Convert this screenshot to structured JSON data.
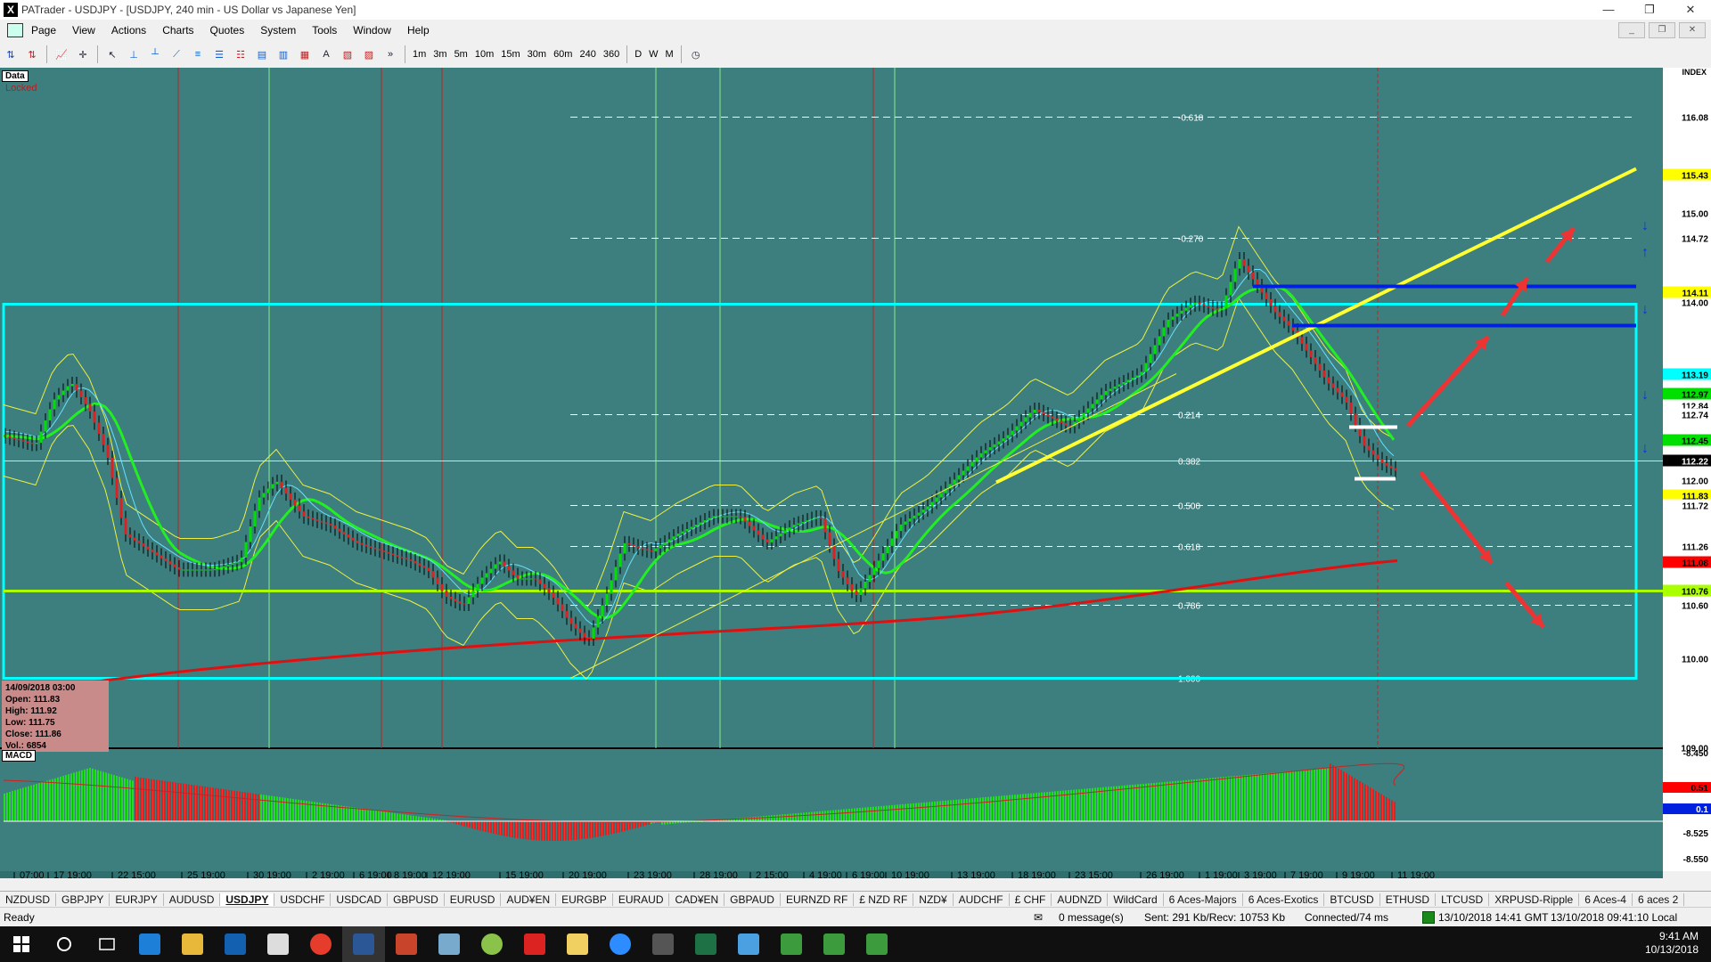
{
  "window": {
    "title": "PATrader - USDJPY - [USDJPY, 240 min - US Dollar vs Japanese Yen]",
    "minimize": "—",
    "restore": "❐",
    "close": "✕"
  },
  "menu": {
    "items": [
      "Page",
      "View",
      "Actions",
      "Charts",
      "Quotes",
      "System",
      "Tools",
      "Window",
      "Help"
    ]
  },
  "toolbar": {
    "timeframes": [
      "1m",
      "3m",
      "5m",
      "10m",
      "15m",
      "30m",
      "60m",
      "240",
      "360"
    ],
    "periods": [
      "D",
      "W",
      "M"
    ],
    "overflow": "»"
  },
  "chart": {
    "data_label": "Data",
    "locked_label": "Locked",
    "index_label": "INDEX",
    "macd_label": "MACD",
    "ohlc": {
      "date": "14/09/2018 03:00",
      "open": "Open: 111.83",
      "high": "High: 111.92",
      "low": "Low: 111.75",
      "close": "Close: 111.86",
      "vol": "Vol.: 6854"
    },
    "price_axis": [
      {
        "label": "116.08",
        "y": 116.08,
        "bg": "#ffffff"
      },
      {
        "label": "115.43",
        "y": 115.43,
        "bg": "#ffff00"
      },
      {
        "label": "115.00",
        "y": 115.0,
        "bg": ""
      },
      {
        "label": "114.72",
        "y": 114.72,
        "bg": "#ffffff"
      },
      {
        "label": "114.11",
        "y": 114.11,
        "bg": "#ffff00"
      },
      {
        "label": "114.00",
        "y": 114.0,
        "bg": ""
      },
      {
        "label": "113.19",
        "y": 113.19,
        "bg": "#00ffff"
      },
      {
        "label": "112.97",
        "y": 112.97,
        "bg": "#00e000"
      },
      {
        "label": "112.84",
        "y": 112.84,
        "bg": "#ffffff"
      },
      {
        "label": "112.74",
        "y": 112.74,
        "bg": "#ffffff"
      },
      {
        "label": "112.45",
        "y": 112.45,
        "bg": "#00e000"
      },
      {
        "label": "112.22",
        "y": 112.22,
        "bg": "#000000"
      },
      {
        "label": "112.00",
        "y": 112.0,
        "bg": ""
      },
      {
        "label": "111.83",
        "y": 111.83,
        "bg": "#ffff00"
      },
      {
        "label": "111.72",
        "y": 111.72,
        "bg": "#ffffff"
      },
      {
        "label": "111.26",
        "y": 111.26,
        "bg": "#ffffff"
      },
      {
        "label": "111.08",
        "y": 111.08,
        "bg": "#ff0000"
      },
      {
        "label": "110.76",
        "y": 110.76,
        "bg": "#aaff00"
      },
      {
        "label": "110.60",
        "y": 110.6,
        "bg": "#ffffff"
      },
      {
        "label": "110.00",
        "y": 110.0,
        "bg": ""
      },
      {
        "label": "109.00",
        "y": 109.0,
        "bg": ""
      }
    ],
    "fib_levels": [
      {
        "label": "-0.618",
        "y": 116.08
      },
      {
        "label": "-0.270",
        "y": 114.72
      },
      {
        "label": "0.214",
        "y": 112.74
      },
      {
        "label": "0.382",
        "y": 112.22
      },
      {
        "label": "0.500",
        "y": 111.72
      },
      {
        "label": "0.618",
        "y": 111.26
      },
      {
        "label": "0.786",
        "y": 110.6
      },
      {
        "label": "1.000",
        "y": 109.78
      }
    ],
    "macd_axis": [
      "-8.450",
      "-8.525",
      "-8.550"
    ],
    "macd_badges": [
      "0.51",
      "0.1"
    ],
    "time_axis": [
      "07:00",
      "17 19:00",
      "22 15:00",
      "25 19:00",
      "30 19:00",
      "2 19:00",
      "6 19:00",
      "8 19:00",
      "12 19:00",
      "15 19:00",
      "20 19:00",
      "23 19:00",
      "28 19:00",
      "2 15:00",
      "4 19:00",
      "6 19:00",
      "10 19:00",
      "13 19:00",
      "18 19:00",
      "23 15:00",
      "26 19:00",
      "1 19:00",
      "3 19:00",
      "7 19:00",
      "9 19:00",
      "11 19:00"
    ]
  },
  "symbols": [
    "NZDUSD",
    "GBPJPY",
    "EURJPY",
    "AUDUSD",
    "USDJPY",
    "USDCHF",
    "USDCAD",
    "GBPUSD",
    "EURUSD",
    "AUD¥EN",
    "EURGBP",
    "EURAUD",
    "CAD¥EN",
    "GBPAUD",
    "EURNZD RF",
    "£ NZD RF",
    "NZD¥",
    "AUDCHF",
    "£ CHF",
    "AUDNZD",
    "WildCard",
    "6 Aces-Majors",
    "6 Aces-Exotics",
    "BTCUSD",
    "ETHUSD",
    "LTCUSD",
    "XRPUSD-Ripple",
    "6 Aces-4",
    "6 aces 2"
  ],
  "active_symbol": "USDJPY",
  "status": {
    "ready": "Ready",
    "messages": "0 message(s)",
    "traffic": "Sent: 291 Kb/Recv: 10753 Kb",
    "connection": "Connected/74 ms",
    "server_time": "13/10/2018 14:41 GMT",
    "local_time": "13/10/2018 09:41:10 Local"
  },
  "taskbar": {
    "time": "9:41 AM",
    "date": "10/13/2018"
  },
  "colors": {
    "chart_bg": "#3d7f7f",
    "bull": "#00e000",
    "bear": "#e02020",
    "ma_fast": "#22ee22",
    "ma_slow": "#e01010",
    "cyan": "#00ffff",
    "trend": "#ffff33"
  }
}
